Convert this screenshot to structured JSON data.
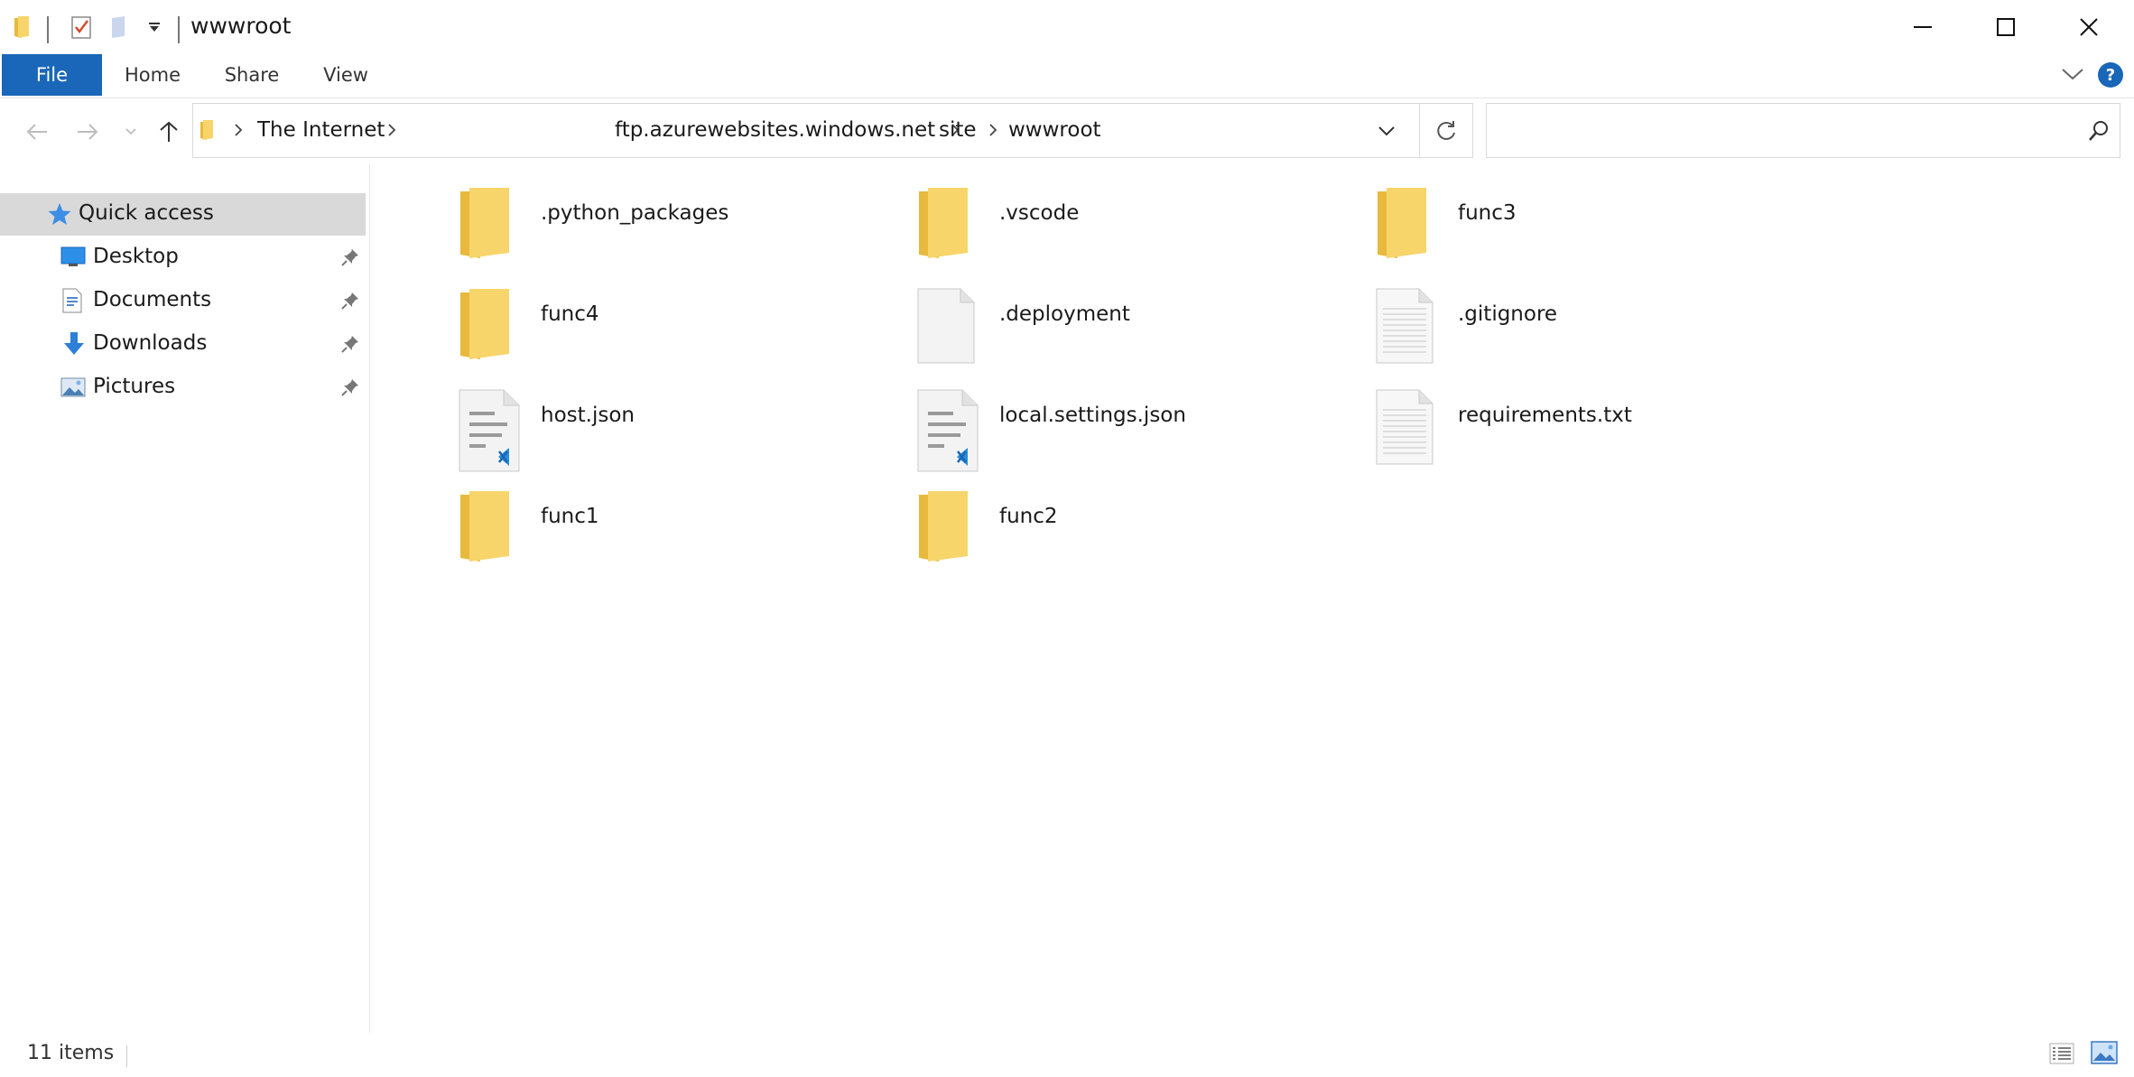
{
  "window": {
    "title": "wwwroot"
  },
  "ribbon": {
    "tabs": [
      {
        "label": "File"
      },
      {
        "label": "Home"
      },
      {
        "label": "Share"
      },
      {
        "label": "View"
      }
    ]
  },
  "address": {
    "crumbs": [
      {
        "label": "The Internet"
      },
      {
        "label": "ftp.azurewebsites.windows.net"
      },
      {
        "label": "site"
      },
      {
        "label": "wwwroot"
      }
    ],
    "search_placeholder": ""
  },
  "nav": {
    "items": [
      {
        "label": "Quick access",
        "icon": "star-icon",
        "pinned": false
      },
      {
        "label": "Desktop",
        "icon": "desktop-icon",
        "pinned": true
      },
      {
        "label": "Documents",
        "icon": "documents-icon",
        "pinned": true
      },
      {
        "label": "Downloads",
        "icon": "download-arrow-icon",
        "pinned": true
      },
      {
        "label": "Pictures",
        "icon": "pictures-icon",
        "pinned": true
      }
    ]
  },
  "files": [
    {
      "name": ".python_packages",
      "kind": "folder"
    },
    {
      "name": ".vscode",
      "kind": "folder"
    },
    {
      "name": "func3",
      "kind": "folder"
    },
    {
      "name": "func4",
      "kind": "folder"
    },
    {
      "name": ".deployment",
      "kind": "blank-file"
    },
    {
      "name": ".gitignore",
      "kind": "text-file"
    },
    {
      "name": "host.json",
      "kind": "vscode-file"
    },
    {
      "name": "local.settings.json",
      "kind": "vscode-file"
    },
    {
      "name": "requirements.txt",
      "kind": "text-file"
    },
    {
      "name": "func1",
      "kind": "folder"
    },
    {
      "name": "func2",
      "kind": "folder"
    }
  ],
  "status": {
    "item_count": "11 items"
  },
  "colors": {
    "accent": "#1a66b8",
    "folder": "#f7d56b",
    "selection": "#d9d9d9"
  }
}
